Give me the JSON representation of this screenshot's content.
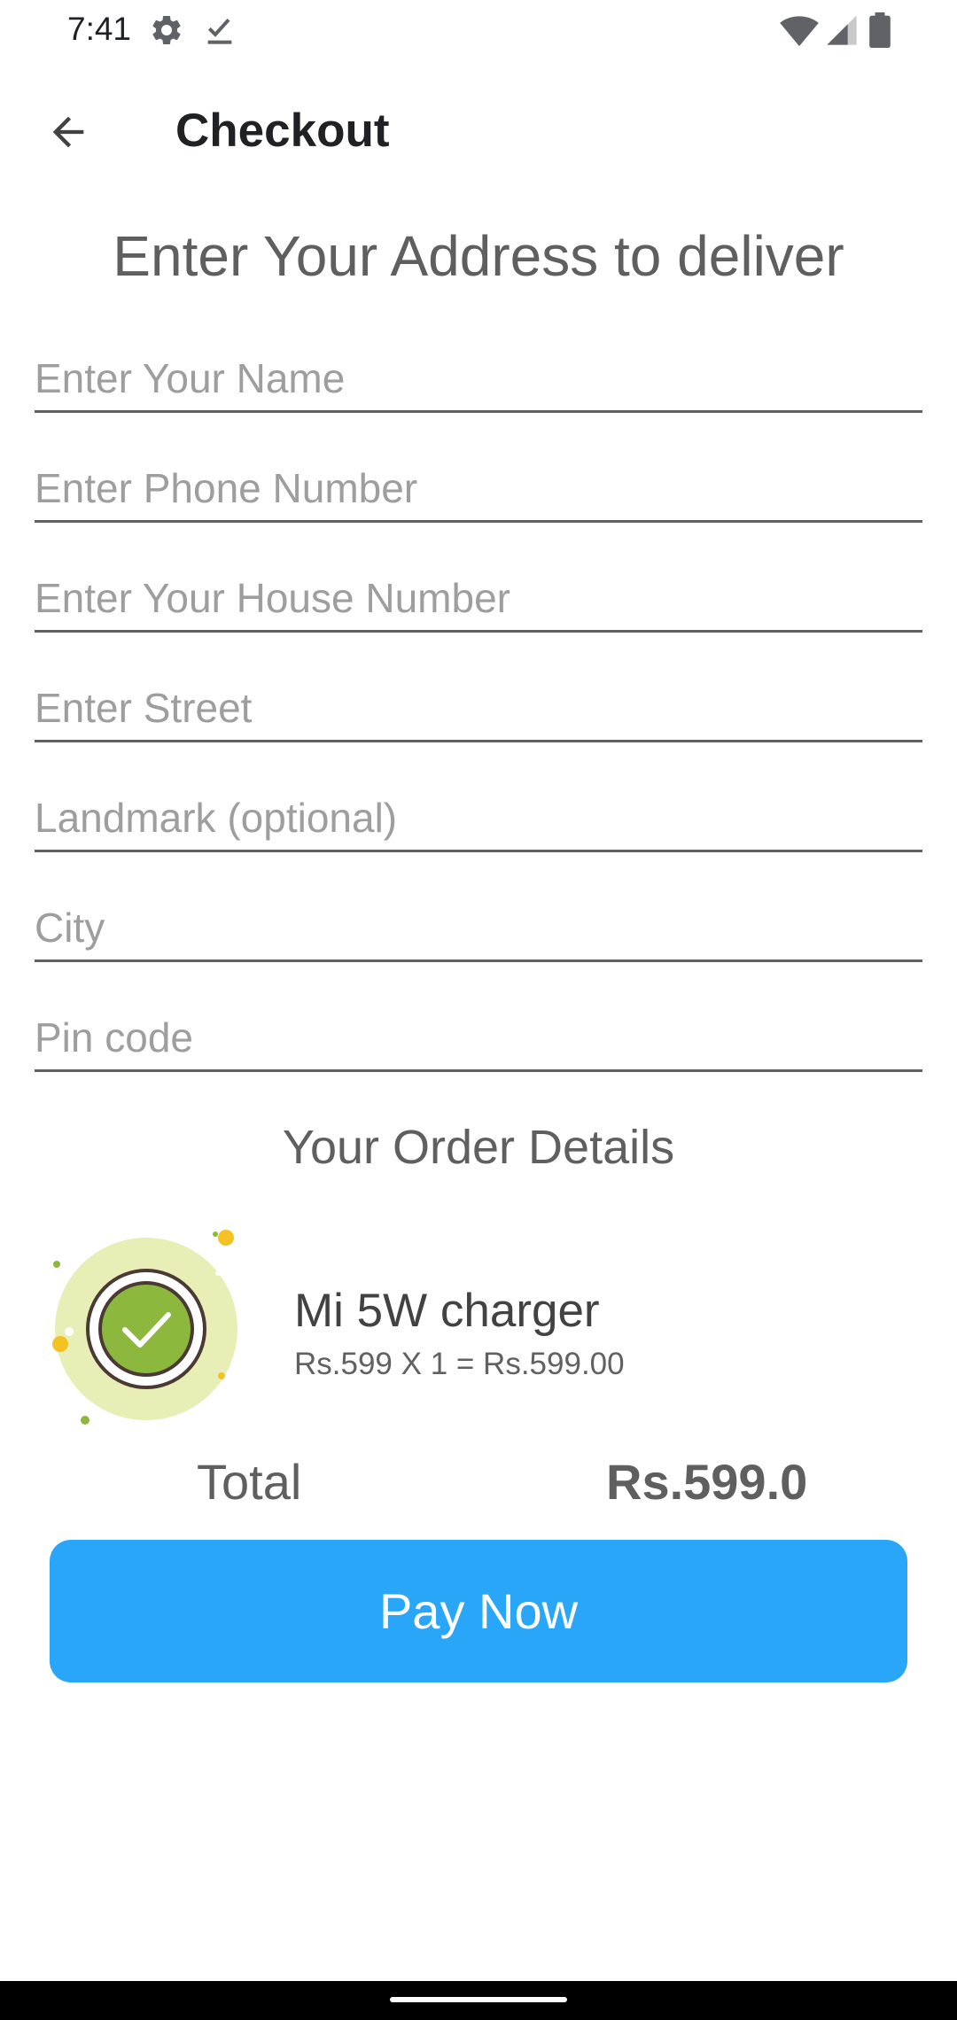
{
  "status_bar": {
    "time": "7:41"
  },
  "app_bar": {
    "title": "Checkout"
  },
  "address_heading": "Enter Your Address to deliver",
  "form": {
    "fields": [
      {
        "placeholder": "Enter Your Name",
        "value": ""
      },
      {
        "placeholder": "Enter Phone Number",
        "value": ""
      },
      {
        "placeholder": "Enter Your House Number",
        "value": ""
      },
      {
        "placeholder": "Enter Street",
        "value": ""
      },
      {
        "placeholder": "Landmark (optional)",
        "value": ""
      },
      {
        "placeholder": "City",
        "value": ""
      },
      {
        "placeholder": "Pin code",
        "value": ""
      }
    ]
  },
  "order_heading": "Your Order Details",
  "order": {
    "items": [
      {
        "name": "Mi 5W charger",
        "price_line": "Rs.599 X 1 = Rs.599.00",
        "icon": "check-badge-icon"
      }
    ],
    "total_label": "Total",
    "total_value": "Rs.599.0"
  },
  "pay_button": {
    "label": "Pay Now",
    "color": "#29a6f7"
  },
  "icons": [
    "gear-icon",
    "task-check-icon",
    "wifi-icon",
    "signal-icon",
    "battery-icon",
    "back-arrow-icon"
  ]
}
